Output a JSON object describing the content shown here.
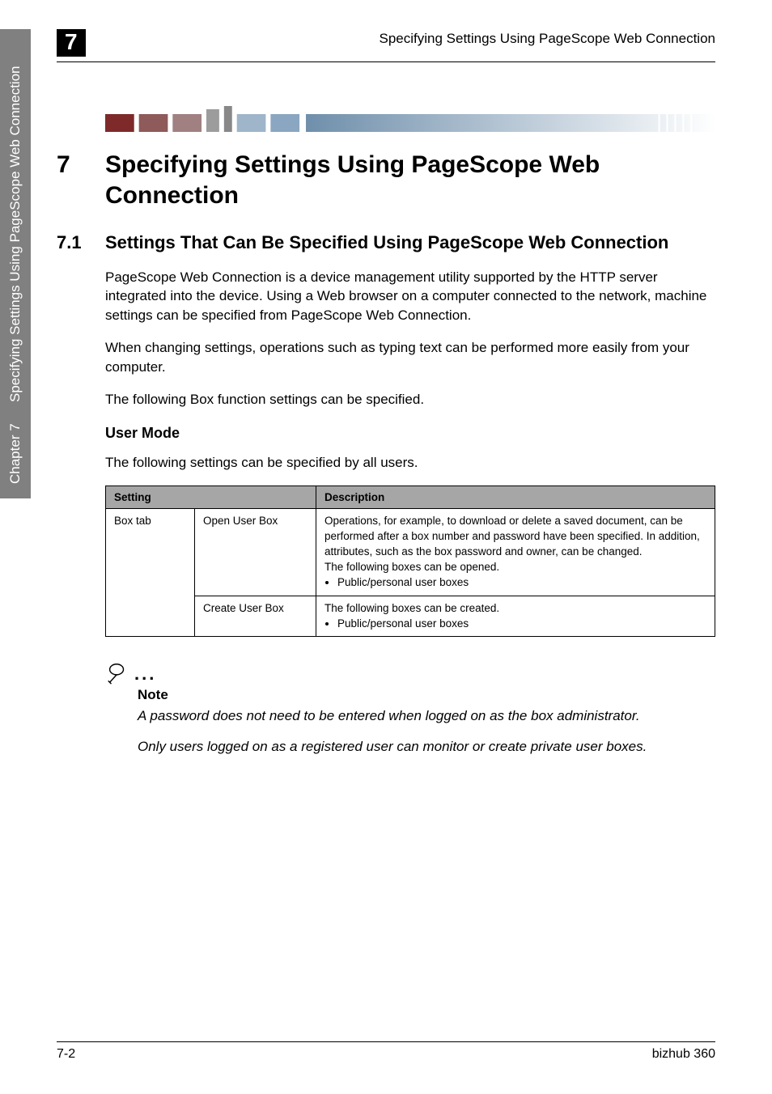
{
  "sidebar": {
    "chapter": "Chapter 7",
    "title": "Specifying Settings Using PageScope Web Connection"
  },
  "header": {
    "page_badge": "7",
    "running_head": "Specifying Settings Using PageScope Web Connection"
  },
  "chapter": {
    "num": "7",
    "title": "Specifying Settings Using PageScope Web Connection"
  },
  "section": {
    "num": "7.1",
    "title": "Settings That Can Be Specified Using PageScope Web Connection"
  },
  "paragraphs": {
    "p1": "PageScope Web Connection is a device management utility supported by the HTTP server integrated into the device. Using a Web browser on a computer connected to the network, machine settings can be specified from PageScope Web Connection.",
    "p2": "When changing settings, operations such as typing text can be performed more easily from your computer.",
    "p3": "The following Box function settings can be specified."
  },
  "subhead": "User Mode",
  "subhead_intro": "The following settings can be specified by all users.",
  "table": {
    "headers": {
      "col1": "Setting",
      "col2": "Description"
    },
    "row1": {
      "setting": "Box tab",
      "sub": "Open User Box",
      "desc_line1": "Operations, for example, to download or delete a saved document, can be performed after a box number and password have been specified. In addition, attributes, such as the box password and owner, can be changed.",
      "desc_line2": "The following boxes can be opened.",
      "bullet": "Public/personal user boxes"
    },
    "row2": {
      "sub": "Create User Box",
      "desc_line1": "The following boxes can be created.",
      "bullet": "Public/personal user boxes"
    }
  },
  "note": {
    "label": "Note",
    "text1": "A password does not need to be entered when logged on as the box administrator.",
    "text2": "Only users logged on as a registered user can monitor or create private user boxes."
  },
  "footer": {
    "left": "7-2",
    "right": "bizhub 360"
  }
}
